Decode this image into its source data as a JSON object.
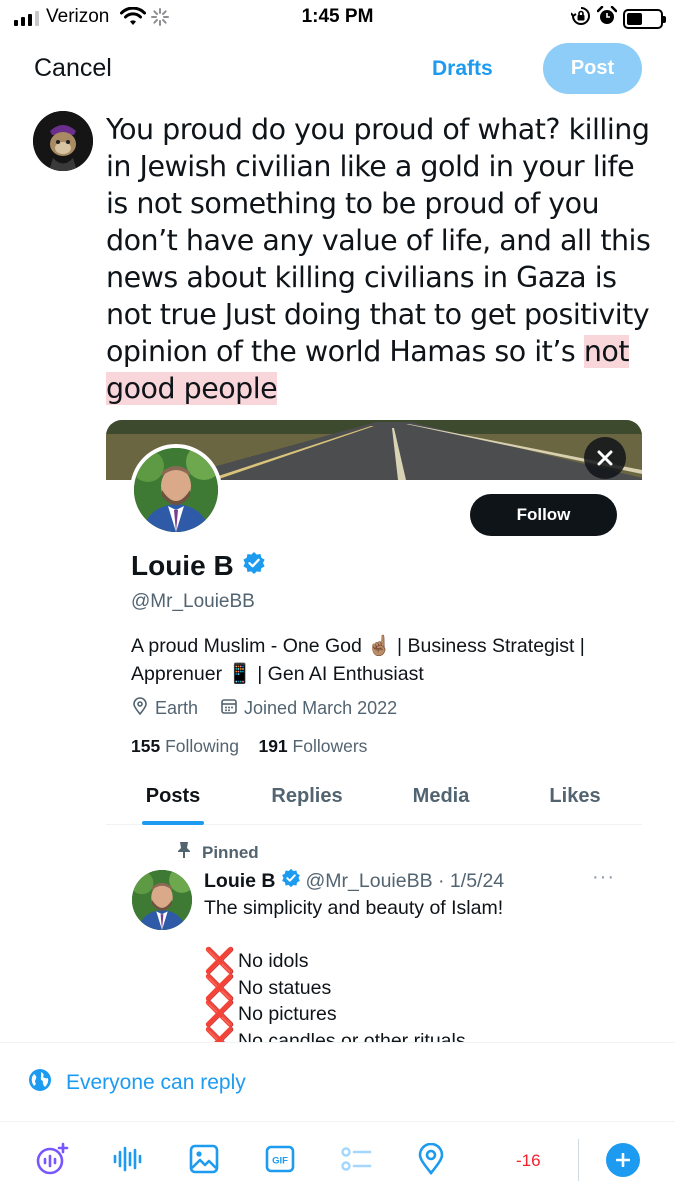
{
  "status_bar": {
    "carrier": "Verizon",
    "time": "1:45 PM"
  },
  "header": {
    "cancel_label": "Cancel",
    "drafts_label": "Drafts",
    "post_label": "Post"
  },
  "compose": {
    "text": "You proud do you proud of what? killing in Jewish civilian like a gold in your life is not something to be proud of you don’t have any value of life, and all this news about killing civilians in Gaza is not true Just doing that to get positivity opinion of the world Hamas so it’s",
    "highlighted_text": "not good people"
  },
  "profile_card": {
    "follow_label": "Follow",
    "name": "Louie B",
    "handle": "@Mr_LouieBB",
    "bio_line1_a": "A proud Muslim - One God",
    "bio_line1_emoji": "☝🏽",
    "bio_line1_b": "| Business Strategist |",
    "bio_line2_a": "Apprenuer",
    "bio_line2_emoji": "📱",
    "bio_line2_b": "| Gen AI Enthusiast",
    "location": "Earth",
    "joined": "Joined March 2022",
    "following_count": "155",
    "following_label": "Following",
    "followers_count": "191",
    "followers_label": "Followers",
    "tabs": [
      {
        "label": "Posts",
        "active": true
      },
      {
        "label": "Replies"
      },
      {
        "label": "Media"
      },
      {
        "label": "Likes"
      }
    ],
    "pinned_label": "Pinned",
    "tweet": {
      "name": "Louie B",
      "handle_date": "@Mr_LouieBB · 1/5/24",
      "text": "The simplicity and beauty of Islam!",
      "list_items": [
        "No idols",
        "No statues",
        "No pictures",
        "No candles or other rituals"
      ],
      "list_marker": "❌"
    }
  },
  "reply_setting": {
    "label": "Everyone can reply"
  },
  "toolbar": {
    "char_count": "-16",
    "icons": [
      "grok-icon",
      "voice-icon",
      "image-icon",
      "gif-icon",
      "poll-icon",
      "location-icon"
    ]
  },
  "colors": {
    "accent": "#1d9bf0",
    "post_disabled": "#8ecdf8",
    "highlight": "#f9d6da",
    "over_limit": "#f4212e",
    "text": "#0f1419",
    "secondary_text": "#536471"
  }
}
